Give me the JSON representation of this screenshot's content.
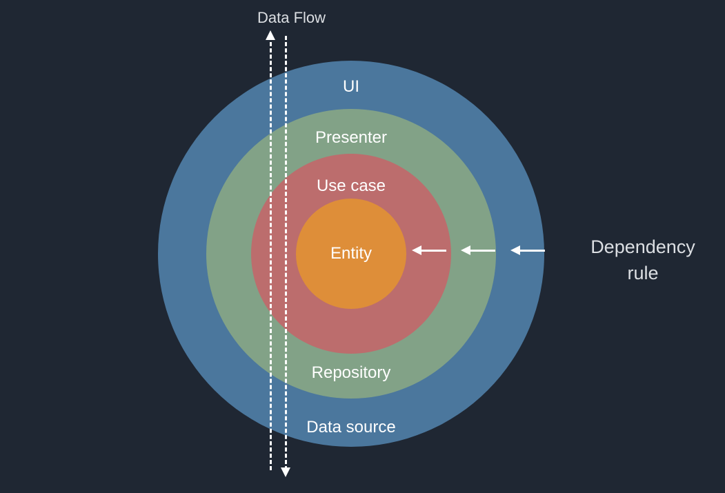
{
  "dataFlowLabel": "Data Flow",
  "dependencyRuleLabel": "Dependency rule",
  "rings": {
    "outer": {
      "top": "UI",
      "bottom": "Data source"
    },
    "second": {
      "top": "Presenter",
      "bottom": "Repository"
    },
    "third": {
      "top": "Use case"
    },
    "core": {
      "label": "Entity"
    }
  },
  "colors": {
    "background": "#1f2733",
    "ui": "#4b779d",
    "presenter": "#82a287",
    "usecase": "#bc6d6d",
    "entity": "#de8e39",
    "text": "#ffffff"
  }
}
